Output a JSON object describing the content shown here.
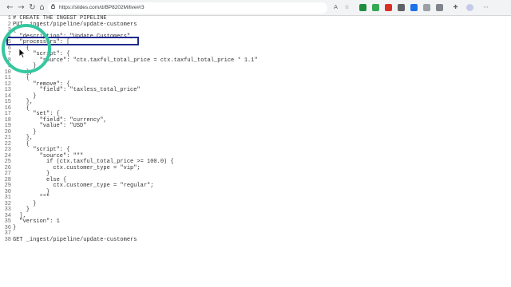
{
  "browser": {
    "url": "https://slides.com/d/BP8202M/live#/3",
    "icons": [
      "back-icon",
      "forward-icon",
      "reload-icon",
      "home-icon"
    ],
    "toolbar_icons": [
      "read-aloud-icon",
      "favorite-icon",
      "extension-icon",
      "extension-icon",
      "extension-icon",
      "extension-icon",
      "extension-icon",
      "extension-icon",
      "extension-icon",
      "profile-icon",
      "menu-icon"
    ]
  },
  "code": {
    "lines": [
      {
        "n": "1",
        "t": "# CREATE THE INGEST PIPELINE"
      },
      {
        "n": "2",
        "t": "PUT _ingest/pipeline/update-customers"
      },
      {
        "n": "3",
        "t": "{"
      },
      {
        "n": "4",
        "t": "  \"description\": \"Update Customers\","
      },
      {
        "n": "5",
        "t": "  \"processors\": ["
      },
      {
        "n": "6",
        "t": "    {"
      },
      {
        "n": "7",
        "t": "      \"script\": {"
      },
      {
        "n": "8",
        "t": "        \"source\": \"ctx.taxful_total_price = ctx.taxful_total_price * 1.1\""
      },
      {
        "n": "9",
        "t": "      }"
      },
      {
        "n": "10",
        "t": "    },"
      },
      {
        "n": "11",
        "t": "    {"
      },
      {
        "n": "12",
        "t": "      \"remove\": {"
      },
      {
        "n": "13",
        "t": "        \"field\": \"taxless_total_price\""
      },
      {
        "n": "14",
        "t": "      }"
      },
      {
        "n": "15",
        "t": "    },"
      },
      {
        "n": "16",
        "t": "    {"
      },
      {
        "n": "17",
        "t": "      \"set\": {"
      },
      {
        "n": "18",
        "t": "        \"field\": \"currency\","
      },
      {
        "n": "19",
        "t": "        \"value\": \"USD\""
      },
      {
        "n": "20",
        "t": "      }"
      },
      {
        "n": "21",
        "t": "    },"
      },
      {
        "n": "22",
        "t": "    {"
      },
      {
        "n": "23",
        "t": "      \"script\": {"
      },
      {
        "n": "24",
        "t": "        \"source\": \"\"\""
      },
      {
        "n": "25",
        "t": "          if (ctx.taxful_total_price >= 100.0) {"
      },
      {
        "n": "26",
        "t": "            ctx.customer_type = \"vip\";"
      },
      {
        "n": "27",
        "t": "          }"
      },
      {
        "n": "28",
        "t": "          else {"
      },
      {
        "n": "29",
        "t": "            ctx.customer_type = \"regular\";"
      },
      {
        "n": "30",
        "t": "          }"
      },
      {
        "n": "31",
        "t": "        \"\"\""
      },
      {
        "n": "32",
        "t": "      }"
      },
      {
        "n": "33",
        "t": "    }"
      },
      {
        "n": "34",
        "t": "  ],"
      },
      {
        "n": "35",
        "t": "  \"version\": 1"
      },
      {
        "n": "36",
        "t": "}"
      },
      {
        "n": "37",
        "t": ""
      },
      {
        "n": "38",
        "t": "GET _ingest/pipeline/update-customers"
      }
    ]
  },
  "colors": {
    "highlight_box": "#1f2b8f",
    "circle": "#35c7a0"
  }
}
